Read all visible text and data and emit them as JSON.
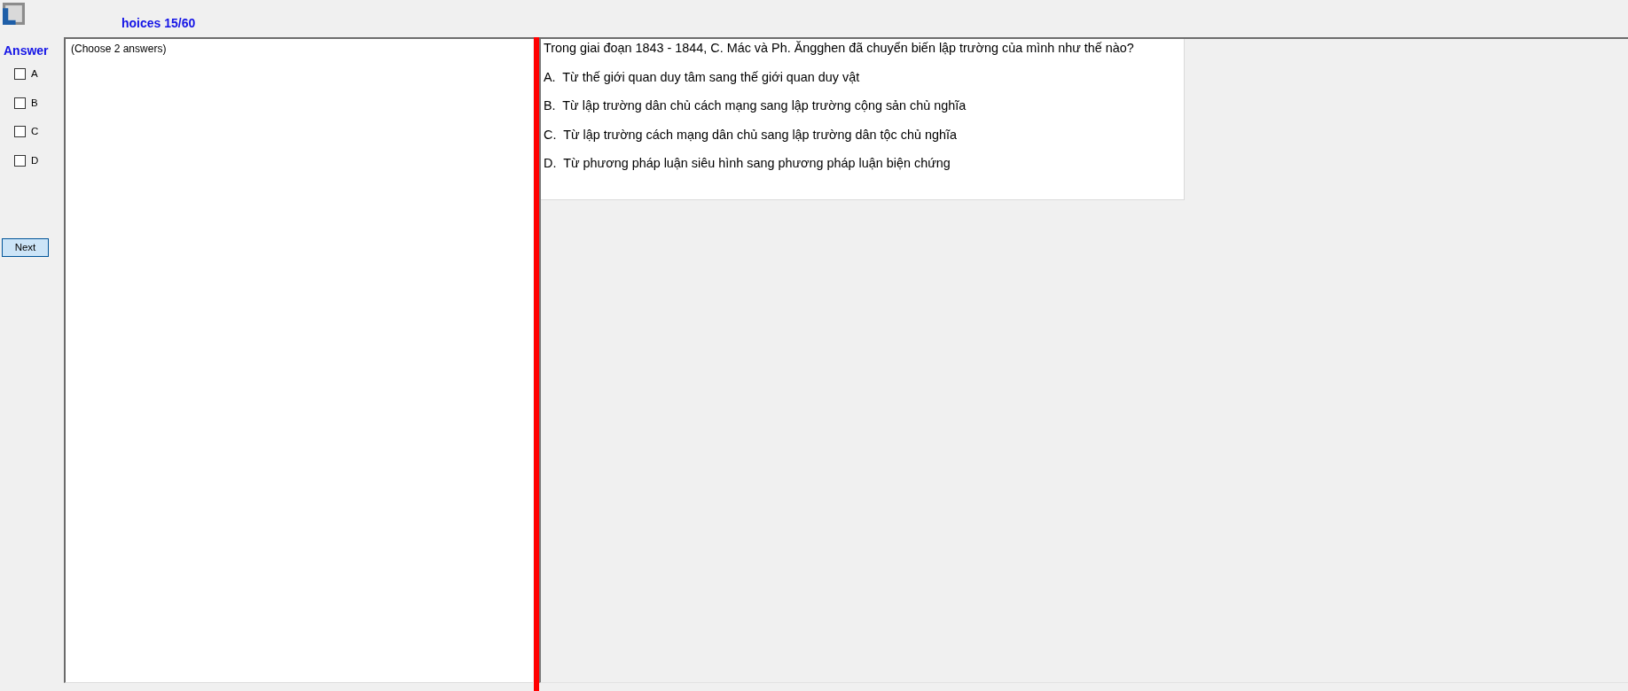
{
  "window": {
    "title": "hoices 15/60"
  },
  "answer_panel": {
    "heading": "Answer",
    "options": [
      {
        "label": "A",
        "checked": false
      },
      {
        "label": "B",
        "checked": false
      },
      {
        "label": "C",
        "checked": false
      },
      {
        "label": "D",
        "checked": false
      }
    ],
    "next_button": "Next"
  },
  "instruction": "(Choose 2 answers)",
  "question": {
    "text": "Trong giai đoạn 1843 - 1844, C. Mác và Ph. Ăngghen đã chuyển biến lập trường của mình như thế nào?",
    "options": [
      "A.  Từ thế giới quan duy tâm sang thế giới quan duy vật",
      "B.  Từ lập trường dân chủ cách mạng sang lập trường cộng sản chủ nghĩa",
      "C.  Từ lập trường cách mạng dân chủ sang lập trường dân tộc chủ nghĩa",
      "D.  Từ phương pháp luận siêu hình sang phương pháp luận biện chứng"
    ]
  }
}
